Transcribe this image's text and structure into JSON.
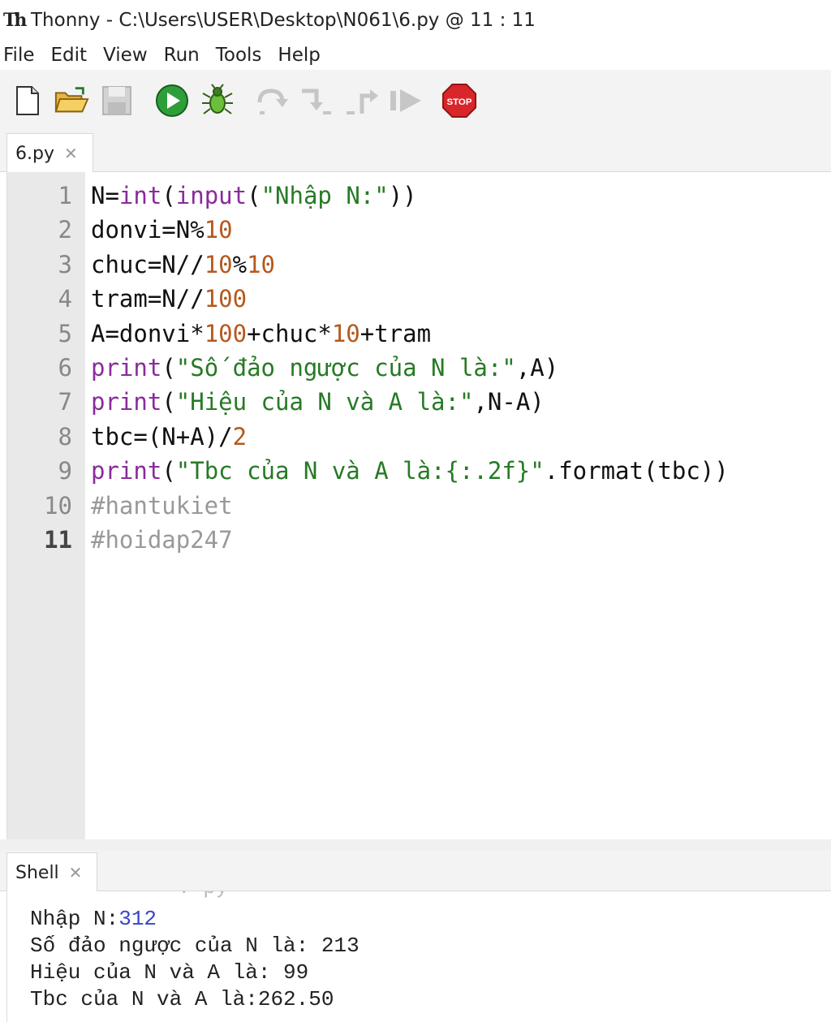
{
  "window": {
    "title": "Thonny  -  C:\\Users\\USER\\Desktop\\N061\\6.py  @  11 : 11",
    "app_icon_text": "Th"
  },
  "menu": [
    "File",
    "Edit",
    "View",
    "Run",
    "Tools",
    "Help"
  ],
  "toolbar": {
    "buttons": [
      "new-file",
      "open-file",
      "save-file",
      "run",
      "debug",
      "step-over",
      "step-into",
      "step-out",
      "resume",
      "stop"
    ],
    "stop_label": "STOP"
  },
  "editor": {
    "tab_label": "6.py",
    "lines": [
      {
        "n": "1",
        "tokens": [
          {
            "t": "N="
          },
          {
            "t": "int",
            "c": "fn"
          },
          {
            "t": "("
          },
          {
            "t": "input",
            "c": "fn"
          },
          {
            "t": "("
          },
          {
            "t": "\"Nhập N:\"",
            "c": "str"
          },
          {
            "t": "))"
          }
        ]
      },
      {
        "n": "2",
        "tokens": [
          {
            "t": "donvi=N%"
          },
          {
            "t": "10",
            "c": "num"
          }
        ]
      },
      {
        "n": "3",
        "tokens": [
          {
            "t": "chuc=N//"
          },
          {
            "t": "10",
            "c": "num"
          },
          {
            "t": "%"
          },
          {
            "t": "10",
            "c": "num"
          }
        ]
      },
      {
        "n": "4",
        "tokens": [
          {
            "t": "tram=N//"
          },
          {
            "t": "100",
            "c": "num"
          }
        ]
      },
      {
        "n": "5",
        "tokens": [
          {
            "t": "A=donvi*"
          },
          {
            "t": "100",
            "c": "num"
          },
          {
            "t": "+chuc*"
          },
          {
            "t": "10",
            "c": "num"
          },
          {
            "t": "+tram"
          }
        ]
      },
      {
        "n": "6",
        "tokens": [
          {
            "t": "print",
            "c": "fn"
          },
          {
            "t": "("
          },
          {
            "t": "\"Số đảo ngược của N là:\"",
            "c": "str"
          },
          {
            "t": ",A)"
          }
        ]
      },
      {
        "n": "7",
        "tokens": [
          {
            "t": "print",
            "c": "fn"
          },
          {
            "t": "("
          },
          {
            "t": "\"Hiệu của N và A là:\"",
            "c": "str"
          },
          {
            "t": ",N-A)"
          }
        ]
      },
      {
        "n": "8",
        "tokens": [
          {
            "t": "tbc=(N+A)/"
          },
          {
            "t": "2",
            "c": "num"
          }
        ]
      },
      {
        "n": "9",
        "tokens": [
          {
            "t": "print",
            "c": "fn"
          },
          {
            "t": "("
          },
          {
            "t": "\"Tbc của N và A là:{:.2f}\"",
            "c": "str"
          },
          {
            "t": ".format(tbc))"
          }
        ]
      },
      {
        "n": "10",
        "tokens": [
          {
            "t": "#hantukiet",
            "c": "cmt"
          }
        ]
      },
      {
        "n": "11",
        "tokens": [
          {
            "t": "#hoidap247",
            "c": "cmt"
          }
        ]
      }
    ],
    "current_line": "11"
  },
  "shell": {
    "tab_label": "Shell",
    "clipped_text": ". py",
    "lines": [
      {
        "prefix": "Nhập N:",
        "input": "312"
      },
      {
        "prefix": "Số đảo ngược của N là: 213",
        "input": ""
      },
      {
        "prefix": "Hiệu của N và A là: 99",
        "input": ""
      },
      {
        "prefix": "Tbc của N và A là:262.50",
        "input": ""
      }
    ]
  }
}
